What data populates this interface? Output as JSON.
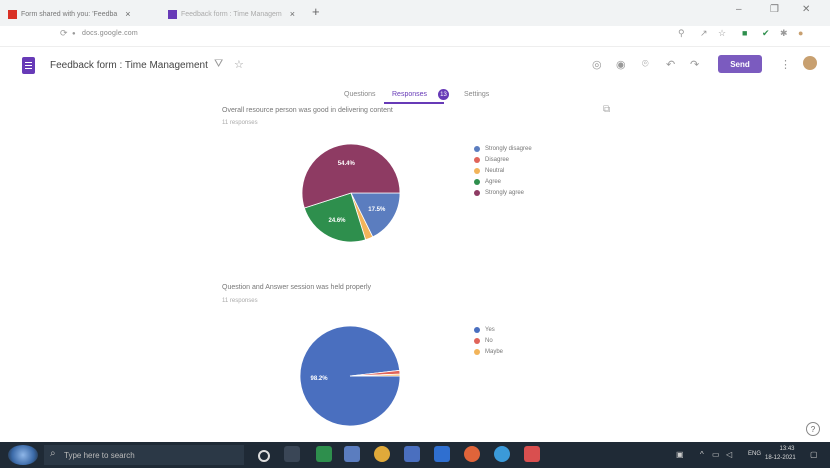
{
  "browser": {
    "tabs": [
      {
        "label": "Form shared with you: 'Feedba",
        "favicon_color": "#d93025"
      },
      {
        "label": "Feedback form : Time Managem",
        "favicon_color": "#673ab7"
      }
    ],
    "new_tab": "+",
    "url": "docs.google.com",
    "window": {
      "minimize": "–",
      "maximize": "❐",
      "close": "✕"
    }
  },
  "form": {
    "title": "Feedback form : Time Management",
    "send_label": "Send",
    "tabs": {
      "questions": "Questions",
      "responses": "Responses",
      "responses_count": "13",
      "settings": "Settings"
    }
  },
  "questions": [
    {
      "title": "Overall resource person was good in delivering content",
      "subtitle": "11 responses",
      "legend": [
        {
          "label": "Strongly disagree",
          "color": "#5b7dbf"
        },
        {
          "label": "Disagree",
          "color": "#e0645a"
        },
        {
          "label": "Neutral",
          "color": "#f2b45a"
        },
        {
          "label": "Agree",
          "color": "#2e8f4d"
        },
        {
          "label": "Strongly agree",
          "color": "#8e3b63"
        }
      ]
    },
    {
      "title": "Question and Answer session was held properly",
      "subtitle": "11 responses",
      "legend": [
        {
          "label": "Yes",
          "color": "#4a6fbf"
        },
        {
          "label": "No",
          "color": "#e0645a"
        },
        {
          "label": "Maybe",
          "color": "#f2b45a"
        }
      ]
    }
  ],
  "chart_data": [
    {
      "type": "pie",
      "labels": [
        "Strongly disagree",
        "Disagree",
        "Neutral",
        "Agree",
        "Strongly agree"
      ],
      "values": [
        17.5,
        0,
        2.5,
        24.6,
        54.4
      ],
      "value_labels": [
        "17.5%",
        "",
        "",
        "24.6%",
        "54.4%"
      ],
      "colors": [
        "#5b7dbf",
        "#e0645a",
        "#f2b45a",
        "#2e8f4d",
        "#8e3b63"
      ],
      "legend": "right"
    },
    {
      "type": "pie",
      "labels": [
        "Yes",
        "No",
        "Maybe"
      ],
      "values": [
        98.2,
        1.2,
        0.6
      ],
      "value_labels": [
        "98.2%",
        "",
        ""
      ],
      "colors": [
        "#4a6fbf",
        "#e0645a",
        "#f2b45a"
      ],
      "legend": "right"
    }
  ],
  "taskbar": {
    "search_placeholder": "Type here to search",
    "language": "ENG",
    "time": "13:43",
    "date": "18-12-2021"
  },
  "help": "?"
}
